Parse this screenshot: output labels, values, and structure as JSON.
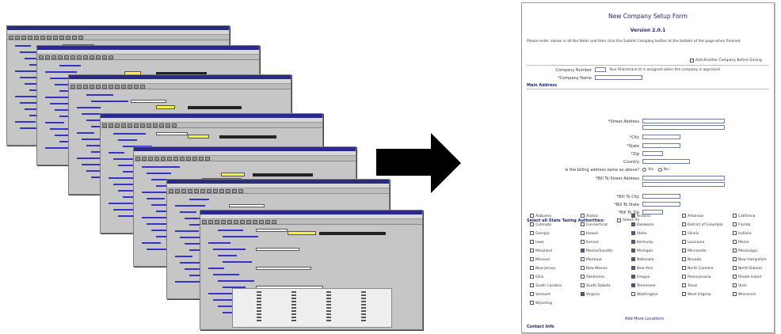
{
  "form": {
    "title": "New Company Setup Form",
    "subtitle": "Version 2.0.1",
    "intro": "Please enter values in all the fields and then click the Submit Company button at the bottom of the page when finished.",
    "add_another_label": "Add Another Company Before Saving",
    "company_number_label": "Company Number",
    "company_number_note": "Your Sharetrack Id is assigned when the company is approved",
    "company_name_label": "*Company Name",
    "main_address_section": "Main Address",
    "street_address_label": "*Street Address",
    "city_label": "*City",
    "state_label": "*State",
    "zip_label": "*Zip",
    "country_label": "Country",
    "billing_question": "Is the billing address same as above?",
    "yes_label": "Yes",
    "no_label": "No",
    "bill_to_address_label": "*Bill To Street Address",
    "bill_to_city_label": "*Bill To City",
    "bill_to_state_label": "*Bill To State",
    "bill_to_zip_label": "*Bill To Zip",
    "states_section": "Select all State Taxing Authorities:",
    "select_all_label": "Select All",
    "more_link": "Add More Locations",
    "contact_section": "Contact Info"
  },
  "states": [
    {
      "name": "Alabama",
      "checked": false
    },
    {
      "name": "Alaska",
      "checked": false
    },
    {
      "name": "Arizona",
      "checked": true
    },
    {
      "name": "Arkansas",
      "checked": false
    },
    {
      "name": "California",
      "checked": false
    },
    {
      "name": "Colorado",
      "checked": false
    },
    {
      "name": "Connecticut",
      "checked": false
    },
    {
      "name": "Delaware",
      "checked": true
    },
    {
      "name": "District of Columbia",
      "checked": false
    },
    {
      "name": "Florida",
      "checked": false
    },
    {
      "name": "Georgia",
      "checked": false
    },
    {
      "name": "Hawaii",
      "checked": false
    },
    {
      "name": "Idaho",
      "checked": true
    },
    {
      "name": "Illinois",
      "checked": false
    },
    {
      "name": "Indiana",
      "checked": false
    },
    {
      "name": "Iowa",
      "checked": false
    },
    {
      "name": "Kansas",
      "checked": false
    },
    {
      "name": "Kentucky",
      "checked": true
    },
    {
      "name": "Louisiana",
      "checked": false
    },
    {
      "name": "Maine",
      "checked": false
    },
    {
      "name": "Maryland",
      "checked": false
    },
    {
      "name": "Massachusetts",
      "checked": true
    },
    {
      "name": "Michigan",
      "checked": true
    },
    {
      "name": "Minnesota",
      "checked": false
    },
    {
      "name": "Mississippi",
      "checked": false
    },
    {
      "name": "Missouri",
      "checked": false
    },
    {
      "name": "Montana",
      "checked": false
    },
    {
      "name": "Nebraska",
      "checked": true
    },
    {
      "name": "Nevada",
      "checked": false
    },
    {
      "name": "New Hampshire",
      "checked": false
    },
    {
      "name": "New Jersey",
      "checked": false
    },
    {
      "name": "New Mexico",
      "checked": false
    },
    {
      "name": "New York",
      "checked": true
    },
    {
      "name": "North Carolina",
      "checked": false
    },
    {
      "name": "North Dakota",
      "checked": false
    },
    {
      "name": "Ohio",
      "checked": false
    },
    {
      "name": "Oklahoma",
      "checked": false
    },
    {
      "name": "Oregon",
      "checked": true
    },
    {
      "name": "Pennsylvania",
      "checked": false
    },
    {
      "name": "Rhode Island",
      "checked": false
    },
    {
      "name": "South Carolina",
      "checked": false
    },
    {
      "name": "South Dakota",
      "checked": false
    },
    {
      "name": "Tennessee",
      "checked": true
    },
    {
      "name": "Texas",
      "checked": false
    },
    {
      "name": "Utah",
      "checked": false
    },
    {
      "name": "Vermont",
      "checked": false
    },
    {
      "name": "Virginia",
      "checked": true
    },
    {
      "name": "Washington",
      "checked": false
    },
    {
      "name": "West Virginia",
      "checked": false
    },
    {
      "name": "Wisconsin",
      "checked": false
    },
    {
      "name": "Wyoming",
      "checked": false
    }
  ],
  "colors": {
    "window_title": "#2a2a8a",
    "window_face": "#c6c6c6",
    "highlight_field": "#ffef3a",
    "form_heading": "#1a2a7a"
  },
  "icons": {
    "arrow": "right-arrow-icon"
  }
}
